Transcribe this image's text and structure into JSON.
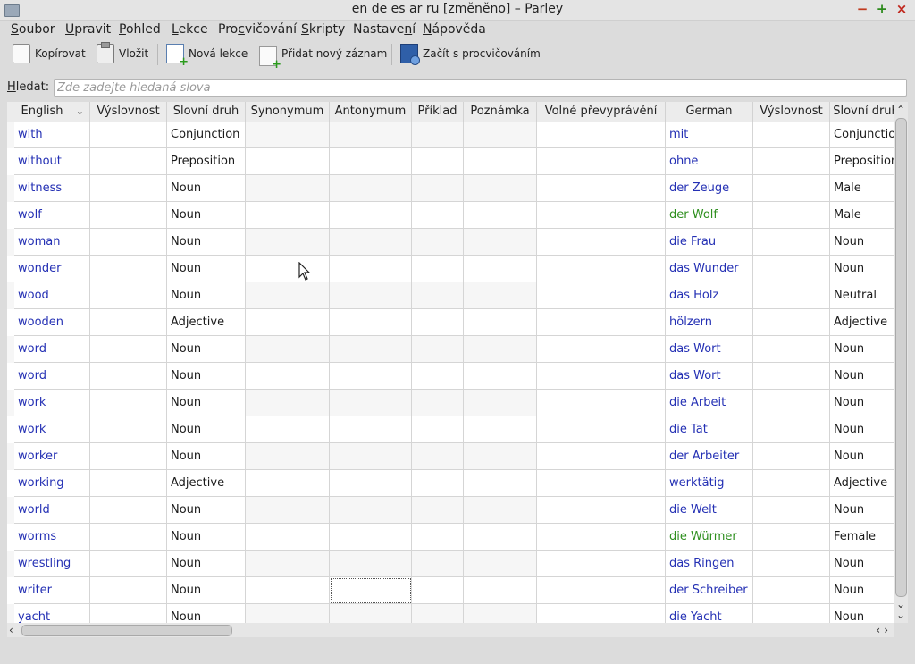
{
  "window": {
    "title": "en de es ar ru [změněno] – Parley"
  },
  "menu": [
    {
      "pre": "",
      "u": "S",
      "post": "oubor"
    },
    {
      "pre": "",
      "u": "U",
      "post": "pravit"
    },
    {
      "pre": "",
      "u": "P",
      "post": "ohled"
    },
    {
      "pre": "",
      "u": "L",
      "post": "ekce"
    },
    {
      "pre": "Pro",
      "u": "c",
      "post": "vičování"
    },
    {
      "pre": "",
      "u": "S",
      "post": "kripty"
    },
    {
      "pre": "Nastave",
      "u": "n",
      "post": "í"
    },
    {
      "pre": "",
      "u": "N",
      "post": "ápověda"
    }
  ],
  "toolbar": {
    "copy": "Kopírovat",
    "paste": "Vložit",
    "new_lesson": "Nová lekce",
    "new_entry": "Přidat nový záznam",
    "start_practice": "Začít s procvičováním"
  },
  "search": {
    "label_u": "H",
    "label_rest": "ledat:",
    "placeholder": "Zde zadejte hledaná slova"
  },
  "columns": [
    "English",
    "Výslovnost",
    "Slovní druh",
    "Synonymum",
    "Antonymum",
    "Příklad",
    "Poznámka",
    "Volné převyprávění",
    "German",
    "Výslovnost",
    "Slovní druh"
  ],
  "rows": [
    {
      "en": "with",
      "pos": "Conjunction",
      "de": "mit",
      "de2": "Conjunction",
      "green": false
    },
    {
      "en": "without",
      "pos": "Preposition",
      "de": "ohne",
      "de2": "Preposition",
      "green": false
    },
    {
      "en": "witness",
      "pos": "Noun",
      "de": "der Zeuge",
      "de2": "Male",
      "green": false
    },
    {
      "en": "wolf",
      "pos": "Noun",
      "de": "der Wolf",
      "de2": "Male",
      "green": true
    },
    {
      "en": "woman",
      "pos": "Noun",
      "de": "die Frau",
      "de2": "Noun",
      "green": false
    },
    {
      "en": "wonder",
      "pos": "Noun",
      "de": "das Wunder",
      "de2": "Noun",
      "green": false
    },
    {
      "en": "wood",
      "pos": "Noun",
      "de": "das Holz",
      "de2": "Neutral",
      "green": false
    },
    {
      "en": "wooden",
      "pos": "Adjective",
      "de": "hölzern",
      "de2": "Adjective",
      "green": false
    },
    {
      "en": "word",
      "pos": "Noun",
      "de": "das Wort",
      "de2": "Noun",
      "green": false
    },
    {
      "en": "word",
      "pos": "Noun",
      "de": "das Wort",
      "de2": "Noun",
      "green": false
    },
    {
      "en": "work",
      "pos": "Noun",
      "de": "die Arbeit",
      "de2": "Noun",
      "green": false
    },
    {
      "en": "work",
      "pos": "Noun",
      "de": "die Tat",
      "de2": "Noun",
      "green": false
    },
    {
      "en": "worker",
      "pos": "Noun",
      "de": "der Arbeiter",
      "de2": "Noun",
      "green": false
    },
    {
      "en": "working",
      "pos": "Adjective",
      "de": "werktätig",
      "de2": "Adjective",
      "green": false
    },
    {
      "en": "world",
      "pos": "Noun",
      "de": "die Welt",
      "de2": "Noun",
      "green": false
    },
    {
      "en": "worms",
      "pos": "Noun",
      "de": "die Würmer",
      "de2": "Female",
      "green": true
    },
    {
      "en": "wrestling",
      "pos": "Noun",
      "de": "das Ringen",
      "de2": "Noun",
      "green": false
    },
    {
      "en": "writer",
      "pos": "Noun",
      "de": "der Schreiber",
      "de2": "Noun",
      "green": false
    },
    {
      "en": "yacht",
      "pos": "Noun",
      "de": "die Yacht",
      "de2": "Noun",
      "green": false
    }
  ]
}
